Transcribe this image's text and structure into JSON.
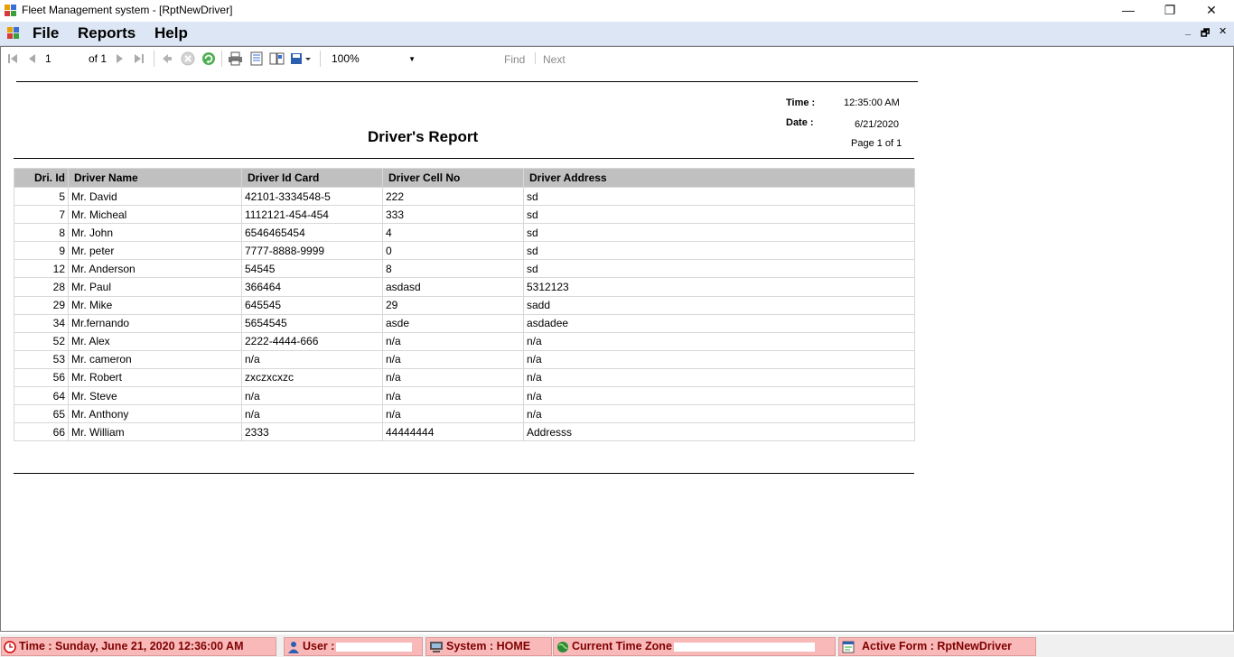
{
  "window": {
    "title": "Fleet Management system - [RptNewDriver]",
    "minimize": "—",
    "restore": "❐",
    "close": "✕"
  },
  "menu": {
    "file": "File",
    "reports": "Reports",
    "help": "Help"
  },
  "mdi": {
    "minimize": "_",
    "restore": "🗗",
    "close": "✕"
  },
  "toolbar": {
    "page_value": "1",
    "of_label": "of 1",
    "zoom": "100%",
    "find_label": "Find",
    "next_label": "Next",
    "icons": [
      "first-page-icon",
      "prev-page-icon",
      "next-page-icon",
      "last-page-icon",
      "back-icon",
      "stop-icon",
      "refresh-icon",
      "print-icon",
      "print-layout-icon",
      "page-setup-icon",
      "export-icon"
    ]
  },
  "report": {
    "title": "Driver's Report",
    "time_label": "Time :",
    "time_value": "12:35:00 AM",
    "date_label": "Date :",
    "date_value": "6/21/2020",
    "page_label": "Page 1 of 1",
    "columns": [
      "Dri. Id",
      "Driver Name",
      "Driver Id Card",
      "Driver Cell No",
      "Driver Address"
    ],
    "rows": [
      [
        "5",
        "Mr. David",
        "42101-3334548-5",
        "222",
        "sd"
      ],
      [
        "7",
        "Mr. Micheal",
        "1112121-454-454",
        "333",
        "sd"
      ],
      [
        "8",
        "Mr. John",
        "6546465454",
        "4",
        "sd"
      ],
      [
        "9",
        "Mr. peter",
        "7777-8888-9999",
        "0",
        "sd"
      ],
      [
        "12",
        "Mr. Anderson",
        "54545",
        "8",
        "sd"
      ],
      [
        "28",
        "Mr. Paul",
        "366464",
        "asdasd",
        "5312123"
      ],
      [
        "29",
        "Mr. Mike",
        "645545",
        "29",
        "sadd"
      ],
      [
        "34",
        "Mr.fernando",
        "5654545",
        "asde",
        "asdadee"
      ],
      [
        "52",
        "Mr. Alex",
        "2222-4444-666",
        "n/a",
        "n/a"
      ],
      [
        "53",
        "Mr. cameron",
        "n/a",
        "n/a",
        "n/a"
      ],
      [
        "56",
        "Mr. Robert",
        "zxczxcxzc",
        "n/a",
        "n/a"
      ],
      [
        "64",
        "Mr. Steve",
        "n/a",
        "n/a",
        "n/a"
      ],
      [
        "65",
        "Mr. Anthony",
        "n/a",
        "n/a",
        "n/a"
      ],
      [
        "66",
        "Mr. William",
        "2333",
        "44444444",
        "Addresss"
      ]
    ]
  },
  "status": {
    "time": "Time : Sunday, June 21, 2020 12:36:00 AM",
    "user": "User :",
    "system": "System : HOME",
    "timezone": "Current Time Zone",
    "active_form": "Active Form : RptNewDriver"
  }
}
